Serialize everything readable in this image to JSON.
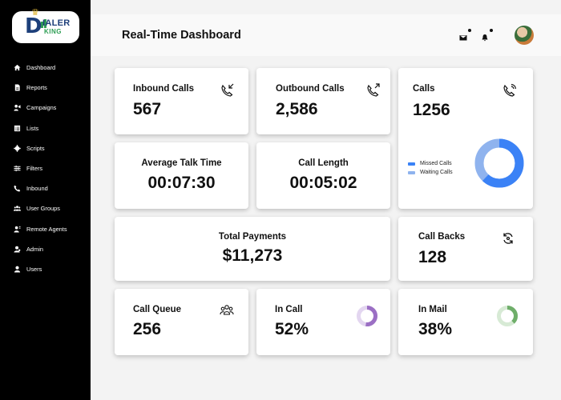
{
  "brand": {
    "logo_letter": "D",
    "logo_top": "IALER",
    "logo_bottom": "KING"
  },
  "sidebar": {
    "items": [
      {
        "label": "Dashboard",
        "icon": "home-icon"
      },
      {
        "label": "Reports",
        "icon": "document-icon"
      },
      {
        "label": "Campaigns",
        "icon": "campaign-icon"
      },
      {
        "label": "Lists",
        "icon": "list-icon"
      },
      {
        "label": "Scripts",
        "icon": "script-icon"
      },
      {
        "label": "Filters",
        "icon": "filter-icon"
      },
      {
        "label": "Inbound",
        "icon": "phone-icon"
      },
      {
        "label": "User Groups",
        "icon": "user-group-icon"
      },
      {
        "label": "Remote Agents",
        "icon": "remote-agent-icon"
      },
      {
        "label": "Admin",
        "icon": "admin-icon"
      },
      {
        "label": "Users",
        "icon": "user-icon"
      }
    ]
  },
  "header": {
    "title": "Real-Time Dashboard"
  },
  "cards": {
    "inbound": {
      "label": "Inbound Calls",
      "value": "567",
      "icon": "phone-incoming-icon"
    },
    "outbound": {
      "label": "Outbound Calls",
      "value": "2,586",
      "icon": "phone-outgoing-icon"
    },
    "calls": {
      "label": "Calls",
      "value": "1256",
      "icon": "phone-icon",
      "legend": [
        {
          "label": "Missed Calls",
          "color": "#3b82f6"
        },
        {
          "label": "Waiting Calls",
          "color": "#8fb3ee"
        }
      ],
      "chart": {
        "missed": 0.62,
        "waiting": 0.38
      }
    },
    "avg_talk": {
      "label": "Average Talk Time",
      "value": "00:07:30"
    },
    "call_length": {
      "label": "Call Length",
      "value": "00:05:02"
    },
    "payments": {
      "label": "Total Payments",
      "value": "$11,273"
    },
    "callbacks": {
      "label": "Call Backs",
      "value": "128",
      "icon": "refresh-icon"
    },
    "queue": {
      "label": "Call Queue",
      "value": "256",
      "icon": "group-icon"
    },
    "in_call": {
      "label": "In Call",
      "value": "52%",
      "percent": 52,
      "color": "#9b6fc4"
    },
    "in_mail": {
      "label": "In Mail",
      "value": "38%",
      "percent": 38,
      "color": "#6fae6a"
    }
  },
  "colors": {
    "sidebar_bg": "#000000",
    "main_bg": "#f3f3f3",
    "accent_blue": "#3b82f6"
  }
}
